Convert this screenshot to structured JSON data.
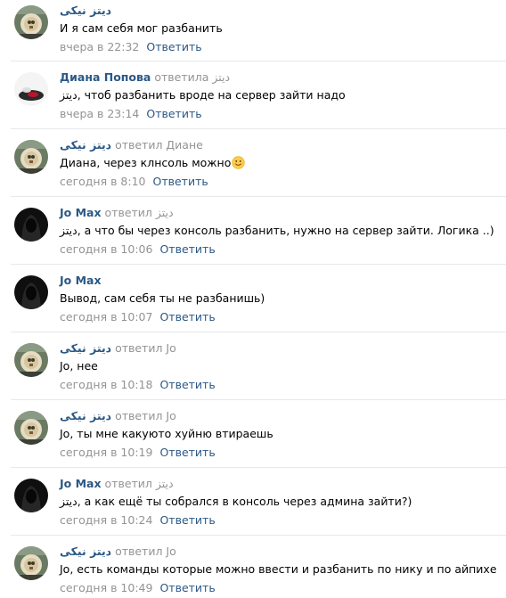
{
  "reply_label": "Ответить",
  "comments": [
    {
      "author": "دیتز نیکی",
      "reply_to": "",
      "text": "И я сам себя мог разбанить",
      "date": "вчера в 22:32",
      "avatar": "dietz"
    },
    {
      "author": "Диана Попова",
      "reply_to": "ответила دیتز",
      "text": "دیتز, чтоб разбанить вроде на сервер зайти надо",
      "date": "вчера в 23:14",
      "avatar": "diana"
    },
    {
      "author": "دیتز نیکی",
      "reply_to": "ответил Диане",
      "text": "Диана, через клнсоль можно",
      "emoji": "smiling-face-emoji",
      "date": "сегодня в 8:10",
      "avatar": "dietz"
    },
    {
      "author": "Jo Max",
      "reply_to": "ответил دیتز",
      "text": "دیتز, а что бы через консоль разбанить, нужно на сервер зайти. Логика ..)",
      "date": "сегодня в 10:06",
      "avatar": "jo"
    },
    {
      "author": "Jo Max",
      "reply_to": "",
      "text": "Вывод, сам себя ты не разбанишь)",
      "date": "сегодня в 10:07",
      "avatar": "jo"
    },
    {
      "author": "دیتز نیکی",
      "reply_to": "ответил Jo",
      "text": "Jo, нее",
      "date": "сегодня в 10:18",
      "avatar": "dietz"
    },
    {
      "author": "دیتز نیکی",
      "reply_to": "ответил Jo",
      "text": "Jo, ты мне какуюто хуйню втираешь",
      "date": "сегодня в 10:19",
      "avatar": "dietz"
    },
    {
      "author": "Jo Max",
      "reply_to": "ответил دیتز",
      "text": "دیتز, а как ещё ты собрался в консоль через админа зайти?)",
      "date": "сегодня в 10:24",
      "avatar": "jo"
    },
    {
      "author": "دیتز نیکی",
      "reply_to": "ответил Jo",
      "text": "Jo, есть команды которые можно ввести и разбанить по нику и по айпихе",
      "date": "сегодня в 10:49",
      "avatar": "dietz"
    }
  ]
}
